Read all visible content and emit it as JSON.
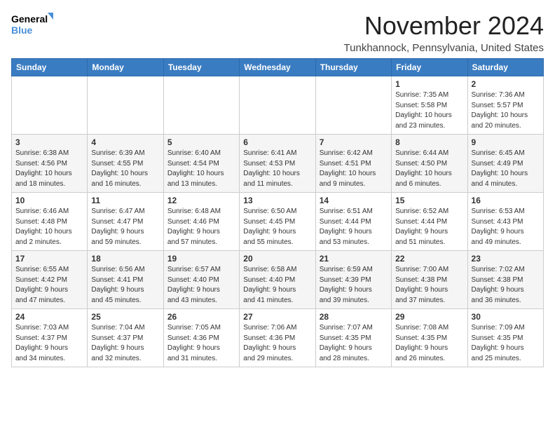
{
  "logo": {
    "line1": "General",
    "line2": "Blue"
  },
  "title": "November 2024",
  "location": "Tunkhannock, Pennsylvania, United States",
  "weekdays": [
    "Sunday",
    "Monday",
    "Tuesday",
    "Wednesday",
    "Thursday",
    "Friday",
    "Saturday"
  ],
  "weeks": [
    [
      {
        "day": "",
        "info": ""
      },
      {
        "day": "",
        "info": ""
      },
      {
        "day": "",
        "info": ""
      },
      {
        "day": "",
        "info": ""
      },
      {
        "day": "",
        "info": ""
      },
      {
        "day": "1",
        "info": "Sunrise: 7:35 AM\nSunset: 5:58 PM\nDaylight: 10 hours\nand 23 minutes."
      },
      {
        "day": "2",
        "info": "Sunrise: 7:36 AM\nSunset: 5:57 PM\nDaylight: 10 hours\nand 20 minutes."
      }
    ],
    [
      {
        "day": "3",
        "info": "Sunrise: 6:38 AM\nSunset: 4:56 PM\nDaylight: 10 hours\nand 18 minutes."
      },
      {
        "day": "4",
        "info": "Sunrise: 6:39 AM\nSunset: 4:55 PM\nDaylight: 10 hours\nand 16 minutes."
      },
      {
        "day": "5",
        "info": "Sunrise: 6:40 AM\nSunset: 4:54 PM\nDaylight: 10 hours\nand 13 minutes."
      },
      {
        "day": "6",
        "info": "Sunrise: 6:41 AM\nSunset: 4:53 PM\nDaylight: 10 hours\nand 11 minutes."
      },
      {
        "day": "7",
        "info": "Sunrise: 6:42 AM\nSunset: 4:51 PM\nDaylight: 10 hours\nand 9 minutes."
      },
      {
        "day": "8",
        "info": "Sunrise: 6:44 AM\nSunset: 4:50 PM\nDaylight: 10 hours\nand 6 minutes."
      },
      {
        "day": "9",
        "info": "Sunrise: 6:45 AM\nSunset: 4:49 PM\nDaylight: 10 hours\nand 4 minutes."
      }
    ],
    [
      {
        "day": "10",
        "info": "Sunrise: 6:46 AM\nSunset: 4:48 PM\nDaylight: 10 hours\nand 2 minutes."
      },
      {
        "day": "11",
        "info": "Sunrise: 6:47 AM\nSunset: 4:47 PM\nDaylight: 9 hours\nand 59 minutes."
      },
      {
        "day": "12",
        "info": "Sunrise: 6:48 AM\nSunset: 4:46 PM\nDaylight: 9 hours\nand 57 minutes."
      },
      {
        "day": "13",
        "info": "Sunrise: 6:50 AM\nSunset: 4:45 PM\nDaylight: 9 hours\nand 55 minutes."
      },
      {
        "day": "14",
        "info": "Sunrise: 6:51 AM\nSunset: 4:44 PM\nDaylight: 9 hours\nand 53 minutes."
      },
      {
        "day": "15",
        "info": "Sunrise: 6:52 AM\nSunset: 4:44 PM\nDaylight: 9 hours\nand 51 minutes."
      },
      {
        "day": "16",
        "info": "Sunrise: 6:53 AM\nSunset: 4:43 PM\nDaylight: 9 hours\nand 49 minutes."
      }
    ],
    [
      {
        "day": "17",
        "info": "Sunrise: 6:55 AM\nSunset: 4:42 PM\nDaylight: 9 hours\nand 47 minutes."
      },
      {
        "day": "18",
        "info": "Sunrise: 6:56 AM\nSunset: 4:41 PM\nDaylight: 9 hours\nand 45 minutes."
      },
      {
        "day": "19",
        "info": "Sunrise: 6:57 AM\nSunset: 4:40 PM\nDaylight: 9 hours\nand 43 minutes."
      },
      {
        "day": "20",
        "info": "Sunrise: 6:58 AM\nSunset: 4:40 PM\nDaylight: 9 hours\nand 41 minutes."
      },
      {
        "day": "21",
        "info": "Sunrise: 6:59 AM\nSunset: 4:39 PM\nDaylight: 9 hours\nand 39 minutes."
      },
      {
        "day": "22",
        "info": "Sunrise: 7:00 AM\nSunset: 4:38 PM\nDaylight: 9 hours\nand 37 minutes."
      },
      {
        "day": "23",
        "info": "Sunrise: 7:02 AM\nSunset: 4:38 PM\nDaylight: 9 hours\nand 36 minutes."
      }
    ],
    [
      {
        "day": "24",
        "info": "Sunrise: 7:03 AM\nSunset: 4:37 PM\nDaylight: 9 hours\nand 34 minutes."
      },
      {
        "day": "25",
        "info": "Sunrise: 7:04 AM\nSunset: 4:37 PM\nDaylight: 9 hours\nand 32 minutes."
      },
      {
        "day": "26",
        "info": "Sunrise: 7:05 AM\nSunset: 4:36 PM\nDaylight: 9 hours\nand 31 minutes."
      },
      {
        "day": "27",
        "info": "Sunrise: 7:06 AM\nSunset: 4:36 PM\nDaylight: 9 hours\nand 29 minutes."
      },
      {
        "day": "28",
        "info": "Sunrise: 7:07 AM\nSunset: 4:35 PM\nDaylight: 9 hours\nand 28 minutes."
      },
      {
        "day": "29",
        "info": "Sunrise: 7:08 AM\nSunset: 4:35 PM\nDaylight: 9 hours\nand 26 minutes."
      },
      {
        "day": "30",
        "info": "Sunrise: 7:09 AM\nSunset: 4:35 PM\nDaylight: 9 hours\nand 25 minutes."
      }
    ]
  ]
}
